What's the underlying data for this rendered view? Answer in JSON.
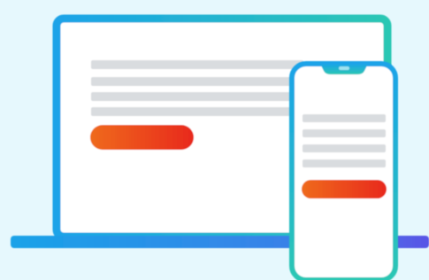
{
  "illustration": {
    "devices": [
      "laptop",
      "smartphone"
    ],
    "laptop": {
      "screen_text_lines": 4,
      "has_button": true
    },
    "smartphone": {
      "screen_text_lines": 4,
      "has_button": true
    }
  },
  "colors": {
    "background": "#e6f8fd",
    "device_frame_start": "#1aa3e8",
    "device_frame_end": "#2cc7b4",
    "laptop_base_start": "#1aa3e8",
    "laptop_base_end": "#5a55e6",
    "placeholder_line": "#d9dcdf",
    "button_start": "#ef5a1c",
    "button_end": "#e8291c",
    "screen_fill": "#ffffff"
  }
}
